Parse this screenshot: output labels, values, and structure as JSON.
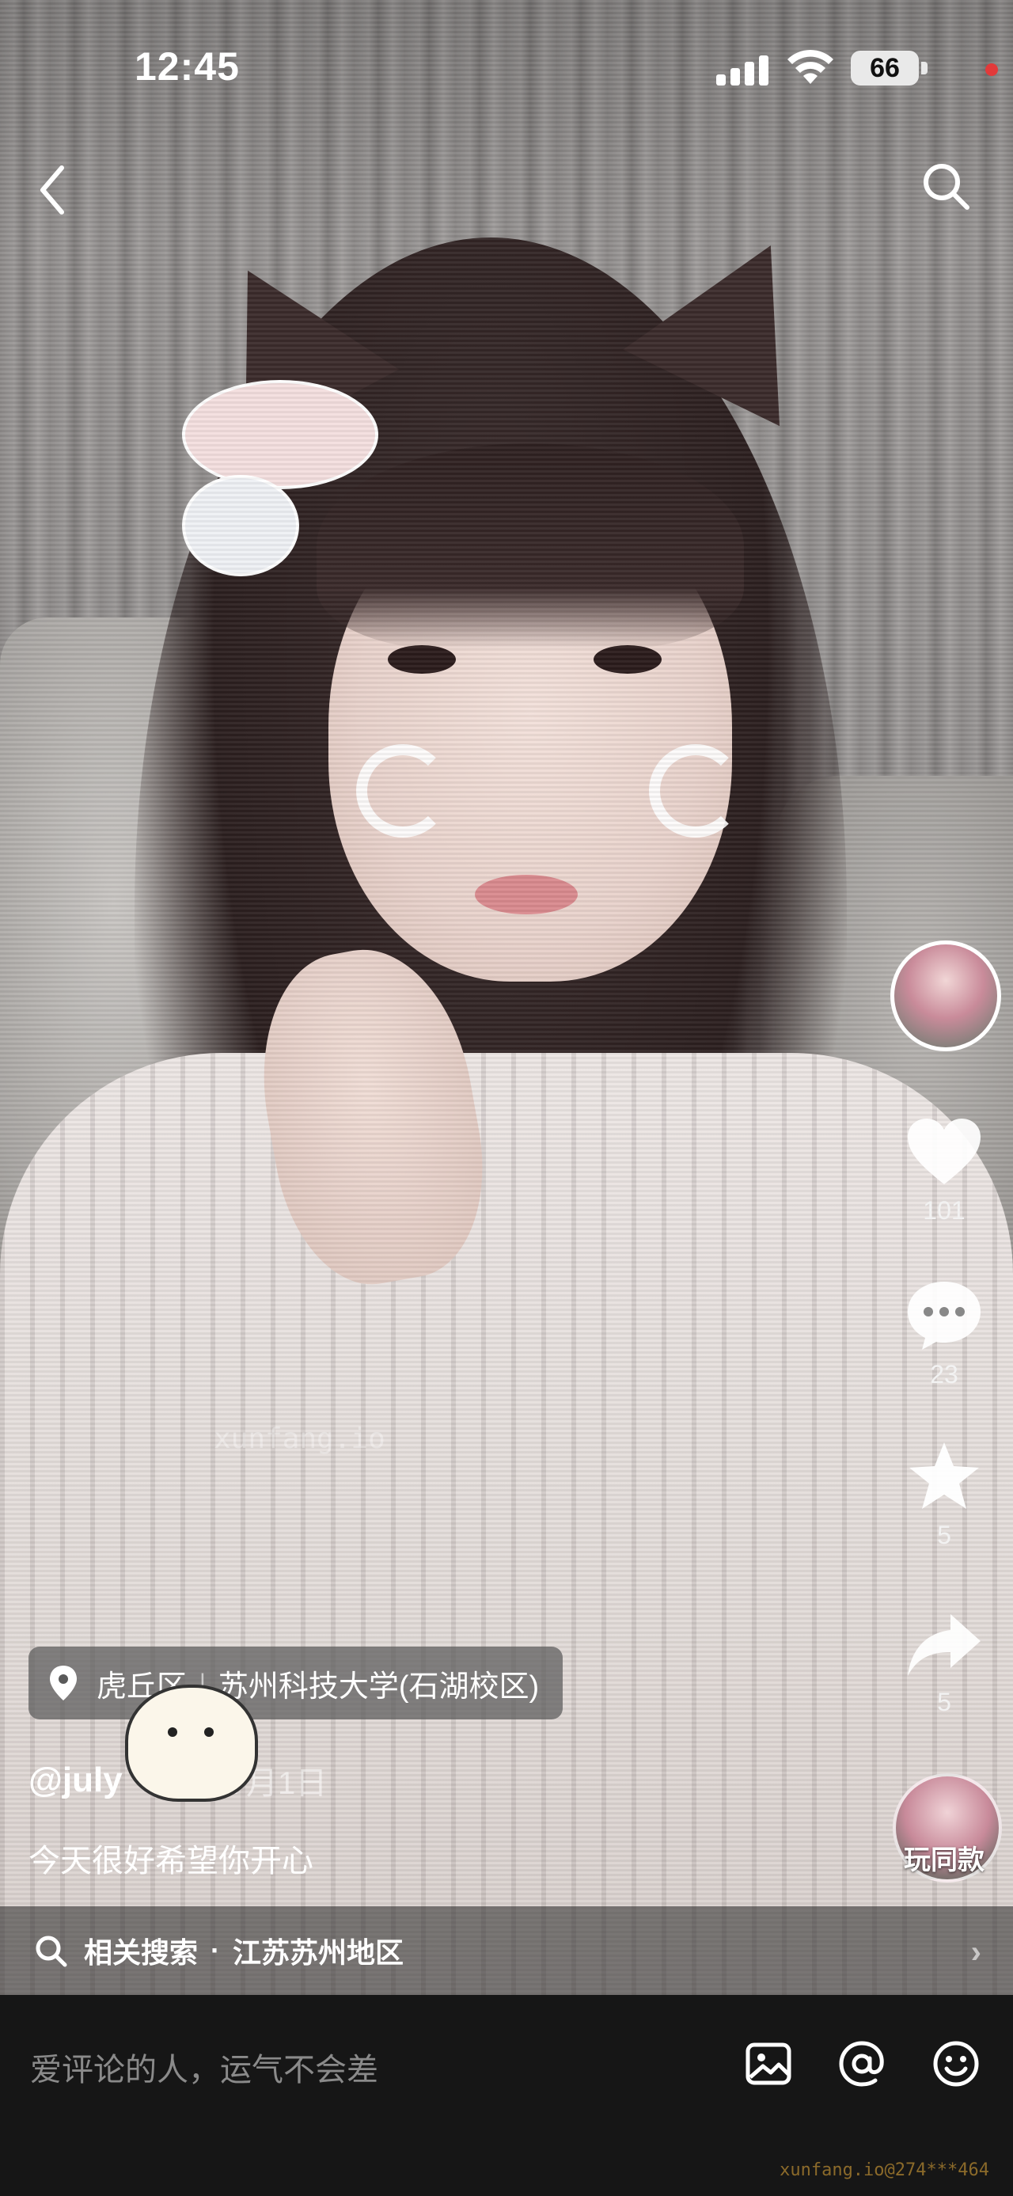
{
  "status_bar": {
    "time": "12:45",
    "battery": "66"
  },
  "video": {
    "watermark_center": "xunfang.io",
    "watermark_corner": "xunfang.io@274***464"
  },
  "nav": {
    "back_icon": "chevron-left-icon",
    "search_icon": "search-icon"
  },
  "rail": {
    "like_count": "101",
    "comment_count": "23",
    "favorite_count": "5",
    "share_count": "5",
    "co_create_label": "玩同款"
  },
  "post": {
    "location_district": "虎丘区",
    "location_place": "苏州科技大学(石湖校区)",
    "author": "@july",
    "date": "7月1日",
    "caption": "今天很好希望你开心"
  },
  "related_search": {
    "label": "相关搜索",
    "separator": "·",
    "query": "江苏苏州地区"
  },
  "comment_bar": {
    "placeholder": "爱评论的人，运气不会差",
    "image_icon": "image-icon",
    "mention_icon": "at-icon",
    "emoji_icon": "emoji-icon"
  },
  "colors": {
    "comment_bar_bg": "#161616",
    "accent_red": "#e23a3a"
  }
}
